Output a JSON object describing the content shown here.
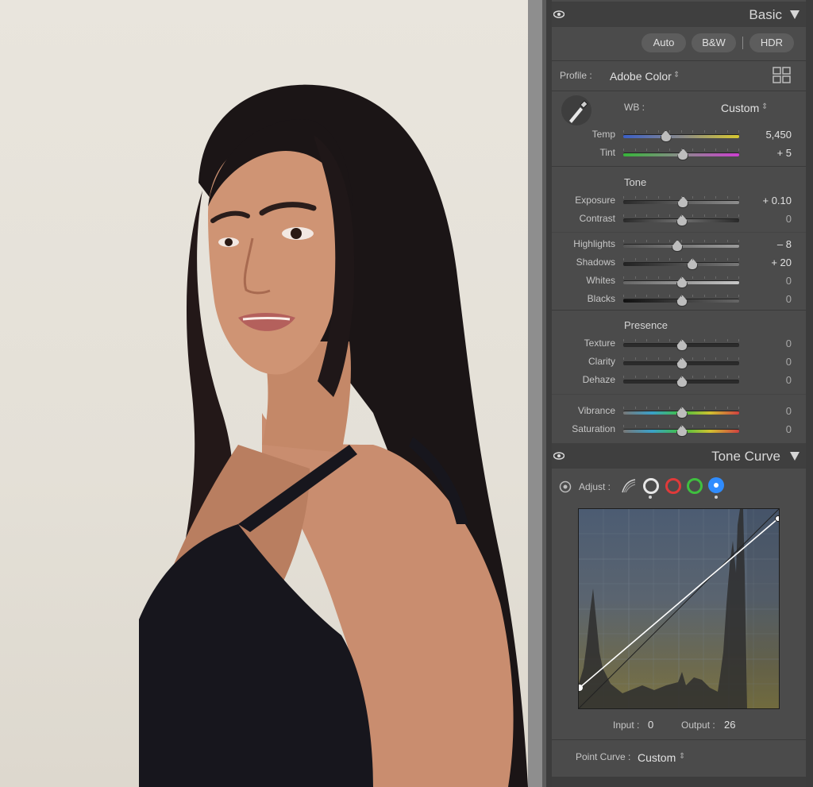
{
  "basic": {
    "title": "Basic",
    "auto": "Auto",
    "bw": "B&W",
    "hdr": "HDR",
    "profile_label": "Profile :",
    "profile_value": "Adobe Color",
    "wb_label": "WB :",
    "wb_value": "Custom",
    "temp": {
      "label": "Temp",
      "value": "5,450",
      "level": 0.36
    },
    "tint": {
      "label": "Tint",
      "value": "+ 5",
      "level": 0.51
    },
    "tone_heading": "Tone",
    "exposure": {
      "label": "Exposure",
      "value": "+ 0.10",
      "level": 0.51
    },
    "contrast": {
      "label": "Contrast",
      "value": "0",
      "level": 0.5
    },
    "highlights": {
      "label": "Highlights",
      "value": "– 8",
      "level": 0.46
    },
    "shadows": {
      "label": "Shadows",
      "value": "+ 20",
      "level": 0.59
    },
    "whites": {
      "label": "Whites",
      "value": "0",
      "level": 0.5
    },
    "blacks": {
      "label": "Blacks",
      "value": "0",
      "level": 0.5
    },
    "presence_heading": "Presence",
    "texture": {
      "label": "Texture",
      "value": "0",
      "level": 0.5
    },
    "clarity": {
      "label": "Clarity",
      "value": "0",
      "level": 0.5
    },
    "dehaze": {
      "label": "Dehaze",
      "value": "0",
      "level": 0.5
    },
    "vibrance": {
      "label": "Vibrance",
      "value": "0",
      "level": 0.5
    },
    "saturation": {
      "label": "Saturation",
      "value": "0",
      "level": 0.5
    }
  },
  "tone_curve": {
    "title": "Tone Curve",
    "adjust_label": "Adjust :",
    "input_label": "Input :",
    "input_value": "0",
    "output_label": "Output :",
    "output_value": "26",
    "point_curve_label": "Point Curve :",
    "point_curve_value": "Custom",
    "channel_colors": [
      "#e6e6e6",
      "#e03a3a",
      "#3fbf3f",
      "#2f8cff"
    ]
  },
  "colors": {
    "panel_bg": "#4b4b4b",
    "header_bg": "#3f3f3f",
    "accent_blue": "#2f8cff"
  }
}
